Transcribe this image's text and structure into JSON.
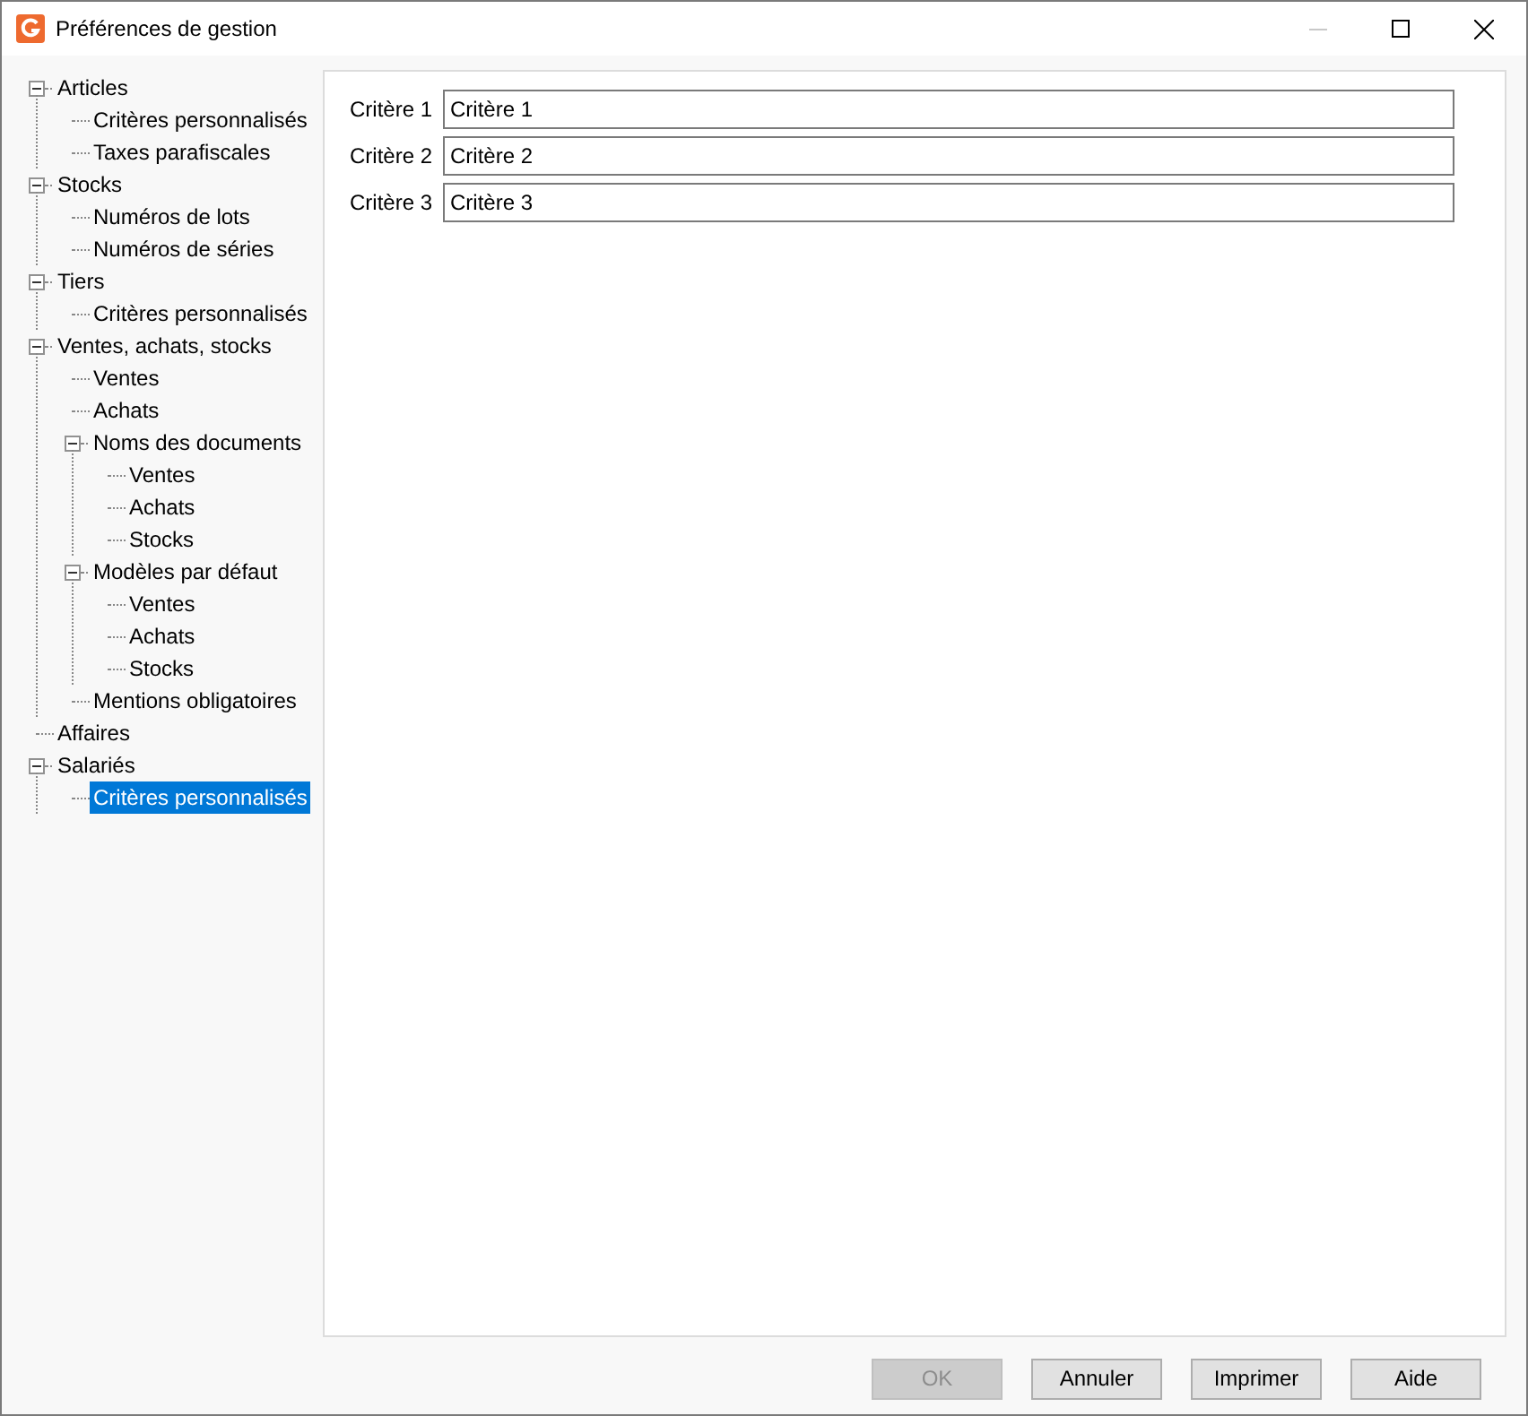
{
  "window": {
    "title": "Préférences de gestion"
  },
  "tree": [
    {
      "label": "Articles",
      "expanded": true,
      "selected": false,
      "children": [
        {
          "label": "Critères personnalisés",
          "selected": false
        },
        {
          "label": "Taxes parafiscales",
          "selected": false
        }
      ]
    },
    {
      "label": "Stocks",
      "expanded": true,
      "selected": false,
      "children": [
        {
          "label": "Numéros de lots",
          "selected": false
        },
        {
          "label": "Numéros de séries",
          "selected": false
        }
      ]
    },
    {
      "label": "Tiers",
      "expanded": true,
      "selected": false,
      "children": [
        {
          "label": "Critères personnalisés",
          "selected": false
        }
      ]
    },
    {
      "label": "Ventes, achats, stocks",
      "expanded": true,
      "selected": false,
      "children": [
        {
          "label": "Ventes",
          "selected": false
        },
        {
          "label": "Achats",
          "selected": false
        },
        {
          "label": "Noms des documents",
          "expanded": true,
          "selected": false,
          "children": [
            {
              "label": "Ventes",
              "selected": false
            },
            {
              "label": "Achats",
              "selected": false
            },
            {
              "label": "Stocks",
              "selected": false
            }
          ]
        },
        {
          "label": "Modèles par défaut",
          "expanded": true,
          "selected": false,
          "children": [
            {
              "label": "Ventes",
              "selected": false
            },
            {
              "label": "Achats",
              "selected": false
            },
            {
              "label": "Stocks",
              "selected": false
            }
          ]
        },
        {
          "label": "Mentions obligatoires",
          "selected": false
        }
      ]
    },
    {
      "label": "Affaires",
      "selected": false
    },
    {
      "label": "Salariés",
      "expanded": true,
      "selected": false,
      "children": [
        {
          "label": "Critères personnalisés",
          "selected": true
        }
      ]
    }
  ],
  "fields": [
    {
      "label": "Critère 1",
      "value": "Critère 1"
    },
    {
      "label": "Critère 2",
      "value": "Critère 2"
    },
    {
      "label": "Critère 3",
      "value": "Critère 3"
    }
  ],
  "buttons": [
    {
      "label": "OK",
      "disabled": true
    },
    {
      "label": "Annuler",
      "disabled": false
    },
    {
      "label": "Imprimer",
      "disabled": false
    },
    {
      "label": "Aide",
      "disabled": false
    }
  ]
}
